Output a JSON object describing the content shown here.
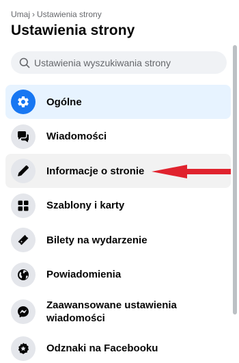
{
  "breadcrumb": {
    "parent": "Umaj",
    "separator": "›",
    "current": "Ustawienia strony"
  },
  "header": {
    "title": "Ustawienia strony"
  },
  "search": {
    "placeholder": "Ustawienia wyszukiwania strony",
    "value": ""
  },
  "menu": {
    "items": [
      {
        "label": "Ogólne",
        "icon": "gear-icon",
        "state": "selected"
      },
      {
        "label": "Wiadomości",
        "icon": "chat-bubbles-icon",
        "state": "normal"
      },
      {
        "label": "Informacje o stronie",
        "icon": "pencil-icon",
        "state": "hover"
      },
      {
        "label": "Szablony i karty",
        "icon": "grid-icon",
        "state": "normal"
      },
      {
        "label": "Bilety na wydarzenie",
        "icon": "ticket-icon",
        "state": "normal"
      },
      {
        "label": "Powiadomienia",
        "icon": "globe-icon",
        "state": "normal"
      },
      {
        "label": "Zaawansowane ustawienia wiadomości",
        "icon": "messenger-icon",
        "state": "normal"
      },
      {
        "label": "Odznaki na Facebooku",
        "icon": "badge-star-icon",
        "state": "normal"
      }
    ]
  },
  "annotation": {
    "arrow_color": "#e0232e",
    "points_to": "Informacje o stronie"
  },
  "colors": {
    "accent": "#1877f2",
    "selected_bg": "#e7f3ff",
    "hover_bg": "#f2f2f2",
    "icon_bg": "#e4e6eb"
  }
}
